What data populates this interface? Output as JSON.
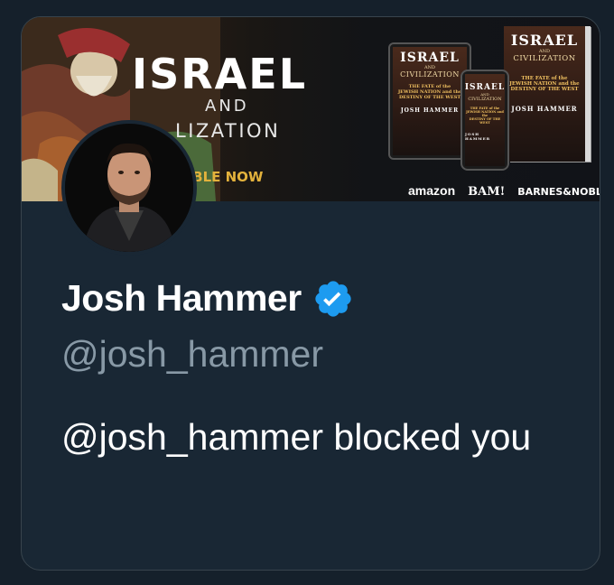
{
  "banner": {
    "title": "ISRAEL",
    "and": "AND",
    "civilization": "LIZATION",
    "available": "LABLE NOW",
    "books": {
      "title": "ISRAEL",
      "and": "AND",
      "civilization": "CIVILIZATION",
      "subtitle_1": "THE FATE of the",
      "subtitle_2": "JEWISH NATION and the",
      "subtitle_3": "DESTINY OF THE WEST",
      "author": "JOSH HAMMER"
    },
    "retailers": [
      "amazon",
      "BAM!",
      "BARNES&NOBLE"
    ]
  },
  "profile": {
    "name": "Josh Hammer",
    "handle": "@josh_hammer",
    "message": "@josh_hammer blocked you"
  },
  "colors": {
    "background": "#15202b",
    "card": "#192734",
    "verified": "#1d9bf0",
    "handle": "#8899a6",
    "accent_gold": "#e3b23c"
  }
}
